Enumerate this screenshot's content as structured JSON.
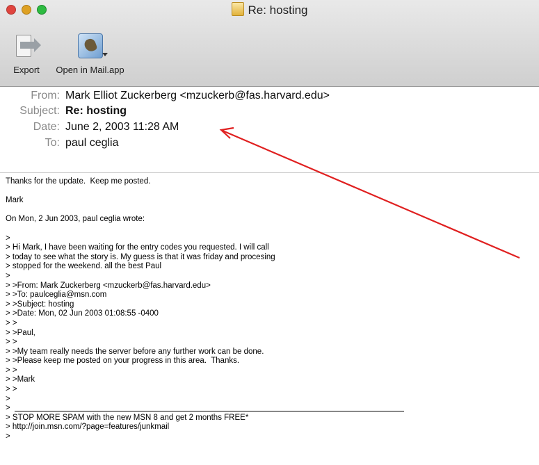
{
  "window": {
    "title": "Re: hosting"
  },
  "toolbar": {
    "export_label": "Export",
    "open_in_mail_label": "Open in Mail.app"
  },
  "headers": {
    "from_label": "From:",
    "from_value": "Mark Elliot Zuckerberg <mzuckerb@fas.harvard.edu>",
    "subject_label": "Subject:",
    "subject_value": "Re: hosting",
    "date_label": "Date:",
    "date_value": "June 2, 2003 11:28 AM",
    "to_label": "To:",
    "to_value": "paul ceglia"
  },
  "body": {
    "lines": [
      "Thanks for the update.  Keep me posted.",
      "",
      "Mark",
      "",
      "On Mon, 2 Jun 2003, paul ceglia wrote:",
      "",
      ">",
      "> Hi Mark, I have been waiting for the entry codes you requested. I will call",
      "> today to see what the story is. My guess is that it was friday and procesing",
      "> stopped for the weekend. all the best Paul",
      ">",
      "> >From: Mark Zuckerberg <mzuckerb@fas.harvard.edu>",
      "> >To: paulceglia@msn.com",
      "> >Subject: hosting",
      "> >Date: Mon, 02 Jun 2003 01:08:55 -0400",
      "> >",
      "> >Paul,",
      "> >",
      "> >My team really needs the server before any further work can be done.",
      "> >Please keep me posted on your progress in this area.  Thanks.",
      "> >",
      "> >Mark",
      "> >",
      ">",
      ">",
      "> STOP MORE SPAM with the new MSN 8 and get 2 months FREE*",
      "> http://join.msn.com/?page=features/junkmail",
      ">"
    ]
  },
  "colors": {
    "annotation_arrow": "#e02020",
    "header_label": "#8a8a8a"
  }
}
